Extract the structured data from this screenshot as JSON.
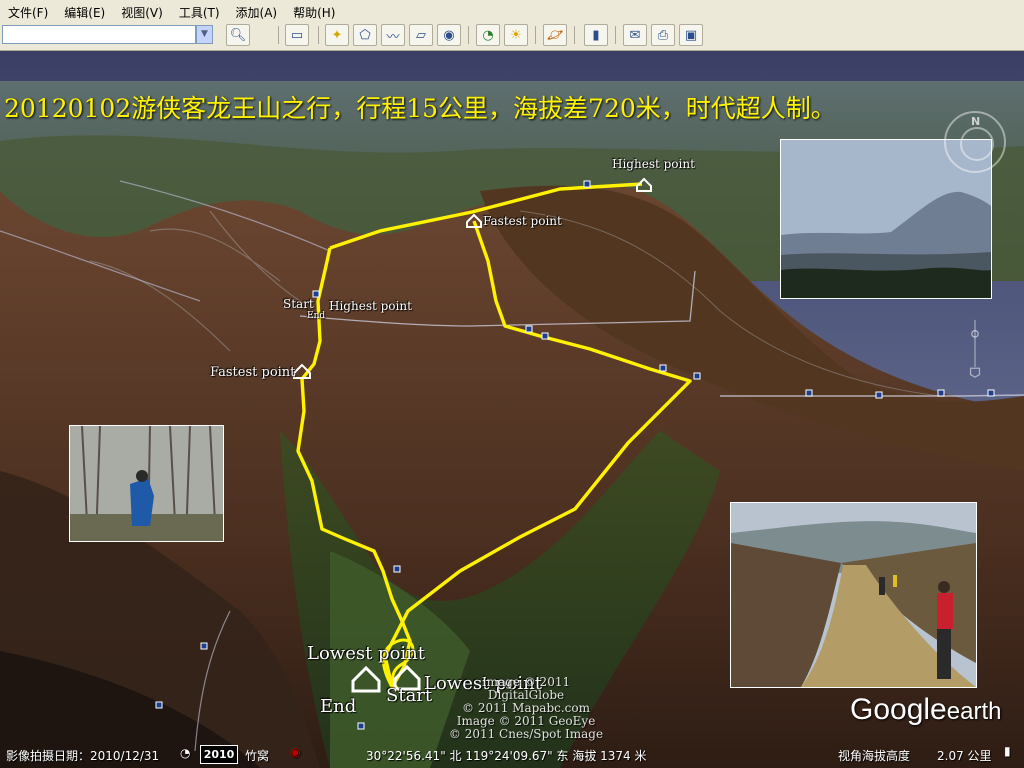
{
  "menubar": {
    "items": [
      "文件(F)",
      "编辑(E)",
      "视图(V)",
      "工具(T)",
      "添加(A)",
      "帮助(H)"
    ]
  },
  "toolbar": {
    "search_value": "",
    "buttons": [
      "sidebar-icon",
      "placemark-icon",
      "polygon-icon",
      "path-icon",
      "overlay-icon",
      "tour-icon",
      "historical-imagery-icon",
      "sunlight-icon",
      "planets-icon",
      "ruler-icon",
      "email-icon",
      "print-icon",
      "save-image-icon"
    ]
  },
  "map": {
    "title": "20120102游侠客龙王山之行，行程15公里，海拔差720米，时代超人制。",
    "labels": {
      "highest_point_top": "Highest point",
      "fastest_point_top": "Fastest point",
      "start_mid": "Start",
      "highest_point_mid": "Highest point",
      "end_mid": "End",
      "fastest_point_left": "Fastest point",
      "lowest_point": "Lowest point",
      "end": "End",
      "start": "Start",
      "lowest_point_partial": "Lowest point"
    },
    "credits": [
      "Image © 2011 DigitalGlobe",
      "© 2011 Mapabc.com",
      "Image © 2011 GeoEye",
      "© 2011 Cnes/Spot Image"
    ],
    "route_color": "#FFF200"
  },
  "logo": {
    "google": "Google",
    "earth": "earth"
  },
  "statusbar": {
    "imagery_date_label": "影像拍摄日期：2010/12/31",
    "year": "2010",
    "place_partial": "竹窝",
    "coordinates": "30°22'56.41\" 北 119°24'09.67\" 东 海拔 1374 米",
    "eye_alt_label": "视角海拔高度",
    "eye_alt_value": "2.07 公里"
  }
}
